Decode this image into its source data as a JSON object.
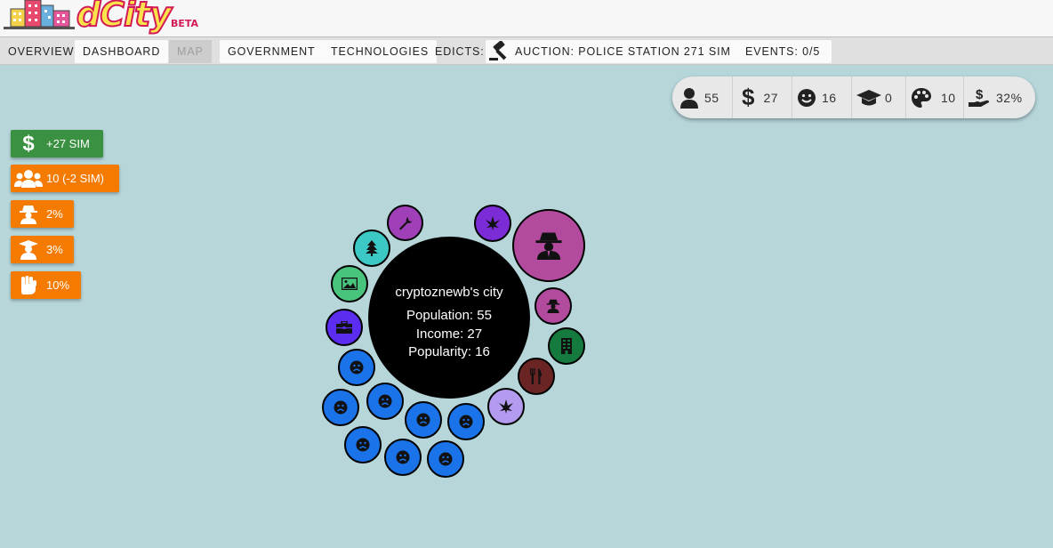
{
  "app": {
    "name": "dCity",
    "tag": "BETA"
  },
  "nav": {
    "overview": "OVERVIEW",
    "dashboard": "DASHBOARD",
    "map": "MAP",
    "government": "GOVERNMENT",
    "technologies": "TECHNOLOGIES",
    "edicts": "EDICTS:",
    "auction": "AUCTION: POLICE STATION 271 SIM",
    "events": "EVENTS: 0/5"
  },
  "stats": {
    "population": "55",
    "income": "27",
    "happiness": "16",
    "education": "0",
    "culture": "10",
    "tax": "32%"
  },
  "badges": {
    "income": "+27 SIM",
    "workers": "10 (-2 SIM)",
    "crime": "2%",
    "education": "3%",
    "unrest": "10%"
  },
  "city": {
    "name": "cryptoznewb's city",
    "population": "Population: 55",
    "income": "Income: 27",
    "popularity": "Popularity: 16"
  },
  "colors": {
    "background": "#b6d6da",
    "green": "#3a9142",
    "orange": "#f47b00",
    "blue": "#1a73e8",
    "purple": "#9c27b0",
    "magenta": "#b04a9c"
  }
}
